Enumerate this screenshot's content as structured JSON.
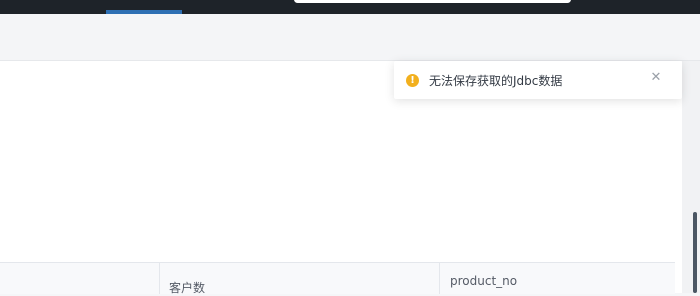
{
  "notification": {
    "type": "warning",
    "message": "无法保存获取的Jdbc数据",
    "icon": "warning-icon",
    "icon_glyph": "!",
    "close_glyph": "✕",
    "accent_color": "#f2b01e"
  },
  "table": {
    "headers": [
      "",
      "客户数",
      "product_no"
    ]
  },
  "colors": {
    "nav_background": "#1e2329",
    "nav_active": "#2d6fb3",
    "panel_background": "#ffffff"
  }
}
